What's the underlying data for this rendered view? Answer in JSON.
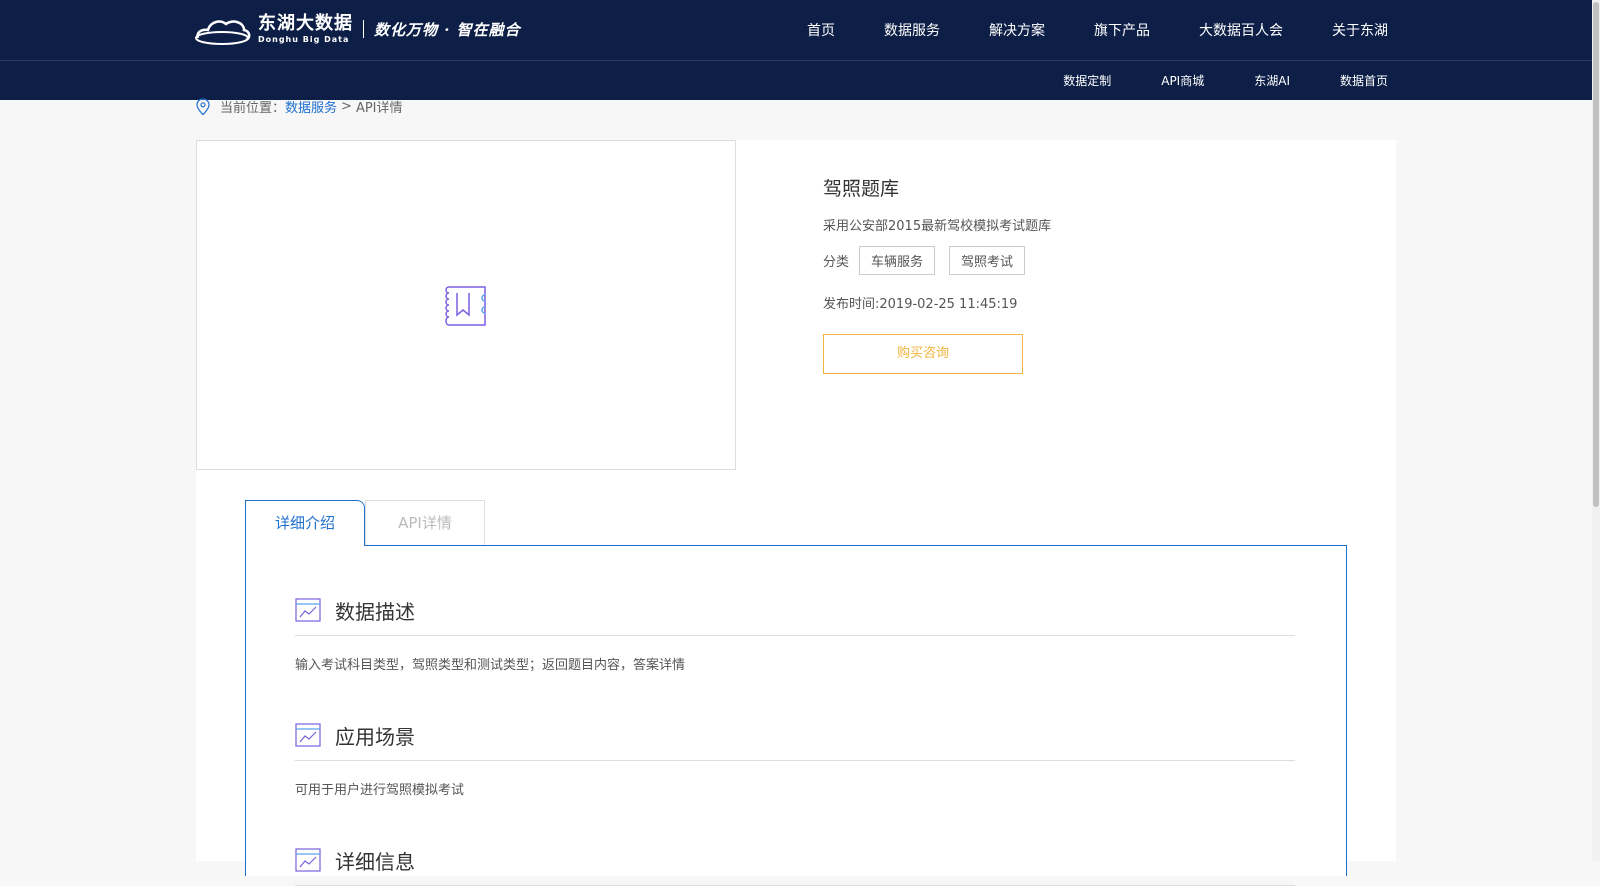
{
  "header": {
    "logo_cn": "东湖大数据",
    "logo_en": "Donghu Big Data",
    "slogan": "数化万物 · 智在融合",
    "nav": [
      "首页",
      "数据服务",
      "解决方案",
      "旗下产品",
      "大数据百人会",
      "关于东湖"
    ],
    "subnav": [
      "数据定制",
      "API商城",
      "东湖AI",
      "数据首页"
    ]
  },
  "breadcrumb": {
    "prefix": "当前位置：",
    "link": "数据服务",
    "separator": ">",
    "current": "API详情"
  },
  "product": {
    "title": "驾照题库",
    "description": "采用公安部2015最新驾校模拟考试题库",
    "category_label": "分类",
    "tags": [
      "车辆服务",
      "驾照考试"
    ],
    "publish_time": "发布时间:2019-02-25 11:45:19",
    "buy_button": "购买咨询"
  },
  "tabs": [
    "详细介绍",
    "API详情"
  ],
  "sections": [
    {
      "title": "数据描述",
      "body": "输入考试科目类型，驾照类型和测试类型；返回题目内容，答案详情"
    },
    {
      "title": "应用场景",
      "body": "可用于用户进行驾照模拟考试"
    },
    {
      "title": "详细信息",
      "body": ""
    }
  ],
  "colors": {
    "header_bg": "#0e1f47",
    "link_blue": "#1f6fcf",
    "button_orange": "#f0b43c",
    "icon_purple": "#7b5fe0"
  }
}
